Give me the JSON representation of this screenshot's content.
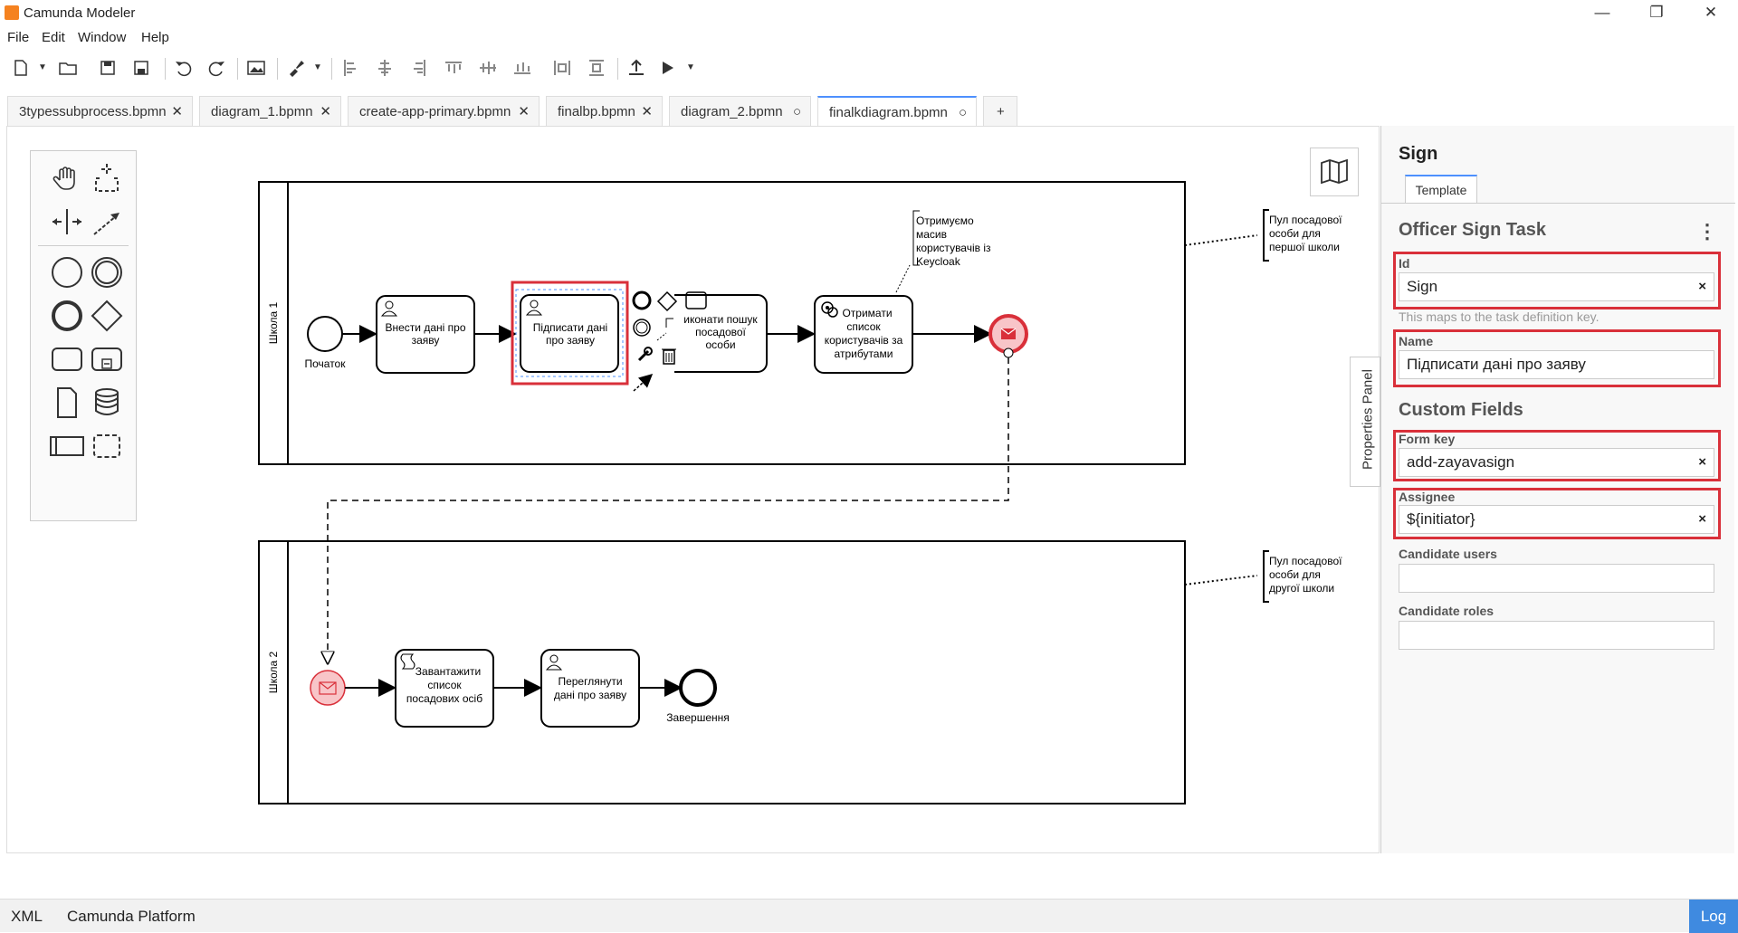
{
  "window": {
    "title": "Camunda Modeler",
    "minimize": "—",
    "restore": "❐",
    "close": "✕"
  },
  "menu": [
    "File",
    "Edit",
    "Window",
    "Help"
  ],
  "tabs": [
    {
      "label": "3typessubprocess.bpmn",
      "close": "✕"
    },
    {
      "label": "diagram_1.bpmn",
      "close": "✕"
    },
    {
      "label": "create-app-primary.bpmn",
      "close": "✕"
    },
    {
      "label": "finalbp.bpmn",
      "close": "✕"
    },
    {
      "label": "diagram_2.bpmn",
      "close": "○"
    },
    {
      "label": "finalkdiagram.bpmn",
      "close": "○"
    }
  ],
  "new_tab": "+",
  "diagram": {
    "lane1": "Школа 1",
    "lane2": "Школа 2",
    "start_label": "Початок",
    "end_label": "Завершення",
    "task_enter": [
      "Внести дані про",
      "заяву"
    ],
    "task_sign": [
      "Підписати дані",
      "про заяву"
    ],
    "task_search": [
      "иконати пошук",
      "посадової",
      "особи"
    ],
    "task_get": [
      "Отримати",
      "список",
      "користувачів за",
      "атрибутами"
    ],
    "task_load": [
      "Завантажити",
      "список",
      "посадових осіб"
    ],
    "task_view": [
      "Переглянути",
      "дані про заяву"
    ],
    "annot_keycloak": [
      "Отримуємо",
      "масив",
      "користувачів із",
      "Keycloak"
    ],
    "annot_pool1": [
      "Пул посадової",
      "особи для",
      "першої школи"
    ],
    "annot_pool2": [
      "Пул посадової",
      "особи для",
      "другої школи"
    ]
  },
  "props": {
    "title": "Sign",
    "tab": "Template",
    "element_type": "Officer Sign Task",
    "kebab": "⋮",
    "id_label": "Id",
    "id_value": "Sign",
    "id_hint": "This maps to the task definition key.",
    "name_label": "Name",
    "name_value": "Підписати дані про заяву",
    "custom_fields": "Custom Fields",
    "formkey_label": "Form key",
    "formkey_value": "add-zayavasign",
    "assignee_label": "Assignee",
    "assignee_value": "${initiator}",
    "cand_users_label": "Candidate users",
    "cand_users_value": "",
    "cand_roles_label": "Candidate roles",
    "cand_roles_value": "",
    "clear": "×"
  },
  "props_toggle": "Properties Panel",
  "status": {
    "xml": "XML",
    "platform": "Camunda Platform",
    "log": "Log"
  },
  "colors": {
    "accent": "#4d90fe",
    "highlight": "#d9303a",
    "log": "#3f8ae0"
  }
}
